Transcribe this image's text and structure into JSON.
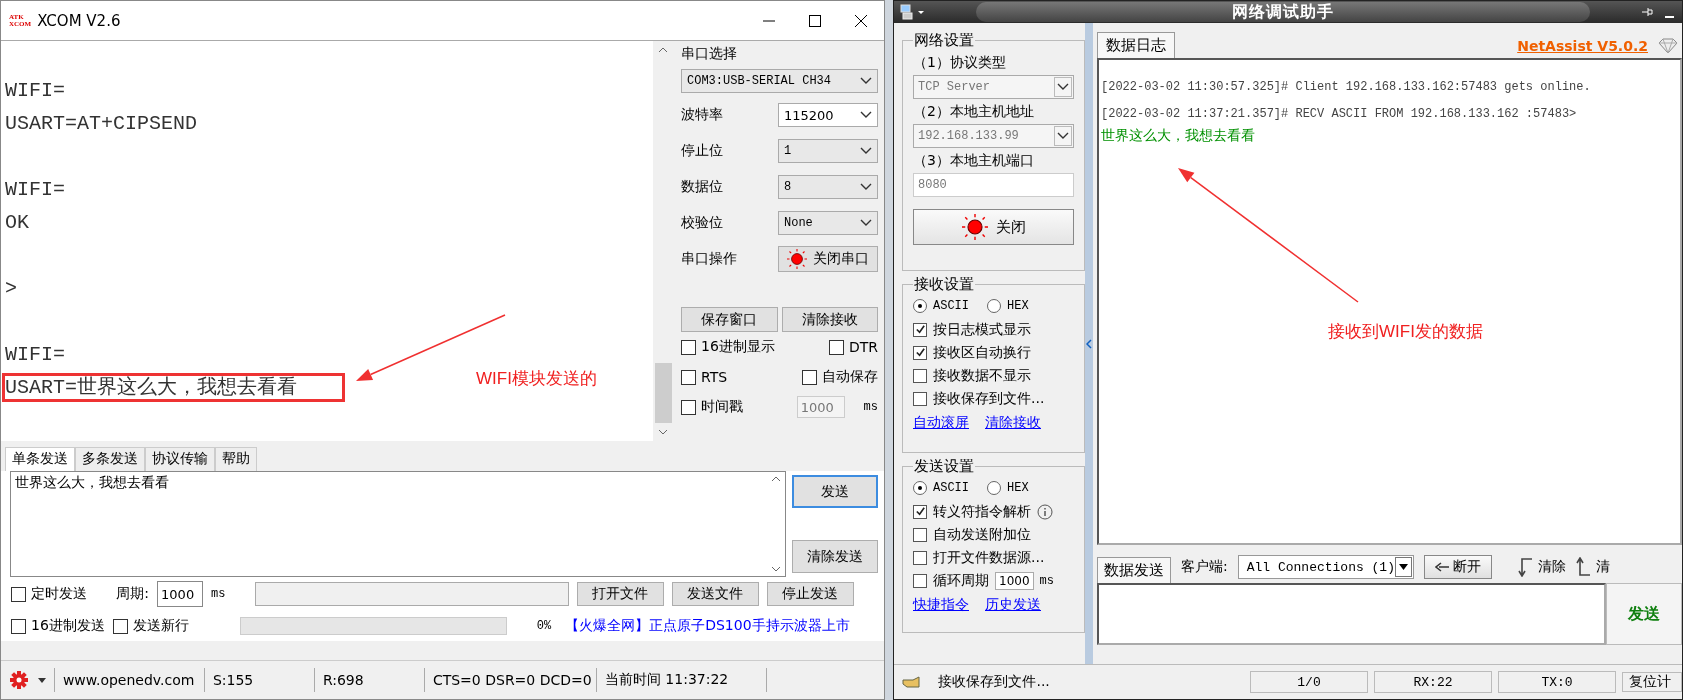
{
  "xcom": {
    "title": "XCOM V2.6",
    "logo": [
      "ATK",
      "XCOM"
    ],
    "receive_lines": [
      {
        "kind": "blank"
      },
      {
        "kind": "text",
        "text": "WIFI=",
        "highlighted": false
      },
      {
        "kind": "text",
        "text": "USART=AT+CIPSEND",
        "highlighted": false
      },
      {
        "kind": "blank"
      },
      {
        "kind": "text",
        "text": "WIFI=",
        "highlighted": false
      },
      {
        "kind": "text",
        "text": "OK",
        "highlighted": false
      },
      {
        "kind": "blank"
      },
      {
        "kind": "text",
        "text": ">",
        "highlighted": false
      },
      {
        "kind": "blank"
      },
      {
        "kind": "text",
        "text": "WIFI=",
        "highlighted": false
      },
      {
        "kind": "text",
        "text": "USART=世界这么大，我想去看看",
        "highlighted": true
      }
    ],
    "port_section": {
      "label": "串口选择",
      "port": "COM3:USB-SERIAL CH34"
    },
    "settings": [
      {
        "label": "波特率",
        "value": "115200",
        "editable": true
      },
      {
        "label": "停止位",
        "value": "1",
        "editable": false
      },
      {
        "label": "数据位",
        "value": "8",
        "editable": false
      },
      {
        "label": "校验位",
        "value": "None",
        "editable": false
      }
    ],
    "operation": {
      "label": "串口操作",
      "button": "关闭串口"
    },
    "buttons": [
      "保存窗口",
      "清除接收"
    ],
    "options": [
      {
        "label": "16进制显示",
        "checked": false
      },
      {
        "label": "DTR",
        "checked": false
      },
      {
        "label": "RTS",
        "checked": false
      },
      {
        "label": "自动保存",
        "checked": false
      },
      {
        "label": "时间戳",
        "checked": false
      }
    ],
    "timestamp": {
      "value": "1000",
      "unit": "ms"
    },
    "tabs": [
      {
        "label": "单条发送",
        "selected": true
      },
      {
        "label": "多条发送",
        "selected": false
      },
      {
        "label": "协议传输",
        "selected": false
      },
      {
        "label": "帮助",
        "selected": false
      }
    ],
    "send_text": "世界这么大，我想去看看",
    "send_buttons": [
      "发送",
      "清除发送"
    ],
    "timed_send": {
      "label": "定时发送",
      "checked": false
    },
    "period": {
      "label": "周期:",
      "value": "1000",
      "unit": "ms"
    },
    "file_buttons": [
      "打开文件",
      "发送文件",
      "停止发送"
    ],
    "hex_send": {
      "label": "16进制发送",
      "checked": false
    },
    "newline": {
      "label": "发送新行",
      "checked": false
    },
    "progress": {
      "level": 0,
      "reading": "0%"
    },
    "ad_link": "【火爆全网】正点原子DS100手持示波器上市",
    "status": [
      "www.openedv.com",
      "S:155",
      "R:698",
      "CTS=0 DSR=0 DCD=0",
      "当前时间 11:37:22"
    ]
  },
  "netassist": {
    "title": "网络调试助手",
    "network": {
      "legend": "网络设置",
      "fields": [
        {
          "label": "（1）协议类型",
          "value": "TCP Server",
          "kind": "combo"
        },
        {
          "label": "（2）本地主机地址",
          "value": "192.168.133.99",
          "kind": "combo"
        },
        {
          "label": "（3）本地主机端口",
          "value": "8080",
          "kind": "input"
        }
      ],
      "button": "关闭"
    },
    "receive": {
      "legend": "接收设置",
      "modes": [
        {
          "label": "ASCII",
          "selected": true
        },
        {
          "label": "HEX",
          "selected": false
        }
      ],
      "options": [
        {
          "label": "按日志模式显示",
          "checked": true
        },
        {
          "label": "接收区自动换行",
          "checked": true
        },
        {
          "label": "接收数据不显示",
          "checked": false
        },
        {
          "label": "接收保存到文件...",
          "checked": false
        }
      ],
      "links": [
        "自动滚屏",
        "清除接收"
      ]
    },
    "send": {
      "legend": "发送设置",
      "modes": [
        {
          "label": "ASCII",
          "selected": true
        },
        {
          "label": "HEX",
          "selected": false
        }
      ],
      "options": [
        {
          "label": "转义符指令解析",
          "checked": true,
          "info": true
        },
        {
          "label": "自动发送附加位",
          "checked": false
        },
        {
          "label": "打开文件数据源...",
          "checked": false
        }
      ],
      "cycle": {
        "label": "循环周期",
        "checked": false,
        "value": "1000",
        "unit": "ms"
      },
      "links": [
        "快捷指令",
        "历史发送"
      ]
    },
    "log_tab": "数据日志",
    "version": "NetAssist V5.0.2",
    "log": [
      {
        "kind": "meta",
        "text": "[2022-03-02 11:30:57.325]# Client 192.168.133.162:57483 gets online."
      },
      {
        "kind": "meta",
        "text": "[2022-03-02 11:37:21.357]# RECV ASCII FROM 192.168.133.162 :57483>"
      },
      {
        "kind": "data",
        "text": "世界这么大，我想去看看"
      }
    ],
    "send_tab": "数据发送",
    "client_label": "客户端:",
    "client": "All Connections (1)",
    "disconnect": "断开",
    "clear": "清除",
    "clear_cut": "清",
    "send_button": "发送",
    "status": {
      "message": "接收保存到文件...",
      "panels": [
        "1/0",
        "RX:22",
        "TX:0"
      ],
      "reset": "复位计"
    }
  },
  "annotations": [
    {
      "text": "WIFI模块发送的"
    },
    {
      "text": "接收到WIFI发的数据"
    }
  ]
}
